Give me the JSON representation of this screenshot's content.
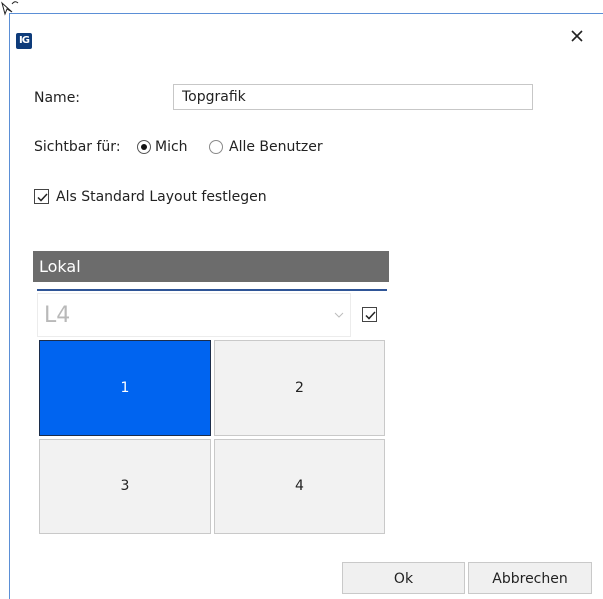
{
  "window": {
    "logo_text": "IG",
    "close_label": "×"
  },
  "form": {
    "name_label": "Name:",
    "name_value": "Topgrafik",
    "visibility_label": "Sichtbar für:",
    "visibility_options": [
      {
        "label": "Mich",
        "checked": true
      },
      {
        "label": "Alle Benutzer",
        "checked": false
      }
    ],
    "default_layout_label": "Als Standard Layout festlegen",
    "default_layout_checked": true
  },
  "section": {
    "title": "Lokal",
    "combo_value": "L4",
    "combo_checked": true,
    "cells": [
      {
        "label": "1",
        "selected": true
      },
      {
        "label": "2",
        "selected": false
      },
      {
        "label": "3",
        "selected": false
      },
      {
        "label": "4",
        "selected": false
      }
    ]
  },
  "footer": {
    "ok_label": "Ok",
    "cancel_label": "Abbrechen"
  },
  "colors": {
    "accent_selected": "#0064f0",
    "header_bg": "#6c6c6c",
    "divider_blue": "#2f5597"
  }
}
